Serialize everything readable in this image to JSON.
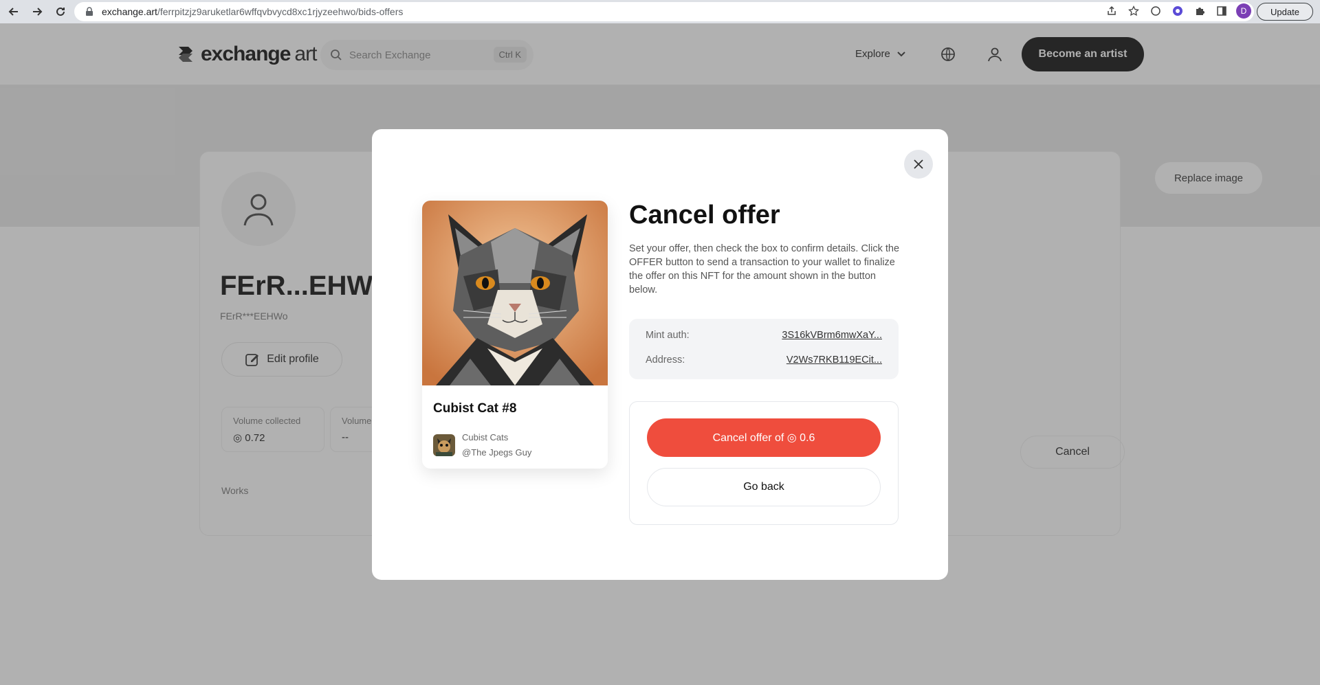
{
  "browser": {
    "url_host": "exchange.art",
    "url_path": "/ferrpitzjz9aruketlar6wffqvbvycd8xc1rjyzeehwo/bids-offers",
    "profile_initial": "D",
    "update_label": "Update"
  },
  "site": {
    "logo_bold": "exchange",
    "logo_light": "art",
    "search_placeholder": "Search Exchange",
    "search_shortcut": "Ctrl K",
    "explore_label": "Explore",
    "become_artist_label": "Become an artist",
    "replace_image_label": "Replace image"
  },
  "profile": {
    "name": "FErR...EHWo",
    "handle": "FErR***EEHWo",
    "edit_label": "Edit profile",
    "stats": [
      {
        "label": "Volume collected",
        "value": "◎ 0.72"
      },
      {
        "label": "Volume",
        "value": "--"
      }
    ],
    "tab_label": "Works",
    "bg_cancel_label": "Cancel"
  },
  "modal": {
    "title": "Cancel offer",
    "description": "Set your offer, then check the box to confirm details. Click the OFFER button to send a transaction to your wallet to finalize the offer on this NFT for the amount shown in the button below.",
    "nft": {
      "title": "Cubist Cat #8",
      "collection": "Cubist Cats",
      "creator": "@The Jpegs Guy"
    },
    "info": {
      "mint_auth_label": "Mint auth:",
      "mint_auth_value": "3S16kVBrm6mwXaY...",
      "address_label": "Address:",
      "address_value": "V2Ws7RKB119ECit..."
    },
    "cancel_offer_label": "Cancel offer of ◎ 0.6",
    "go_back_label": "Go back"
  },
  "colors": {
    "accent_red": "#ef4d3d",
    "overlay": "rgba(70,70,70,0.42)"
  }
}
